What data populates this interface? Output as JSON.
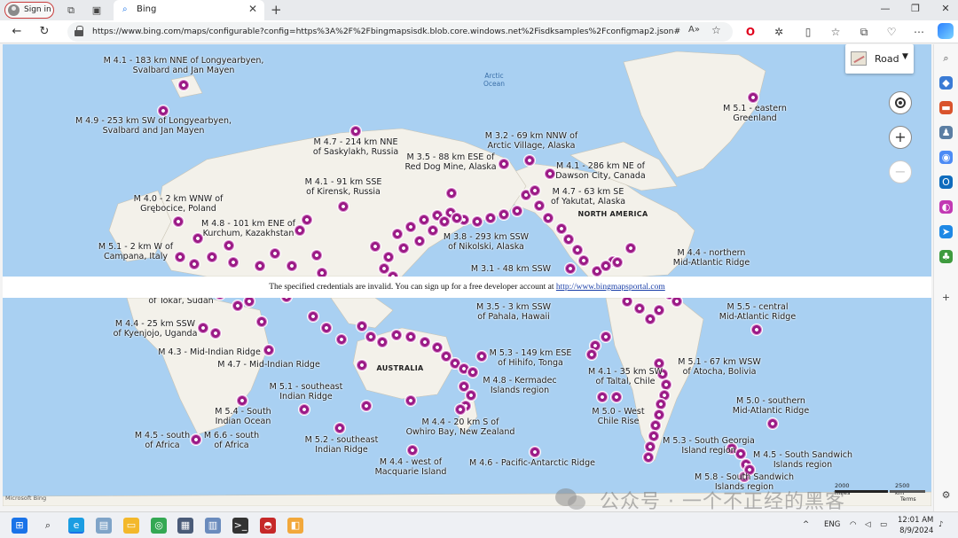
{
  "browser": {
    "signin_label": "Sign in",
    "tab_title": "Bing",
    "url": "https://www.bing.com/maps/configurable?config=https%3A%2F%2Fbingmapsisdk.blob.core.windows.net%2Fisdksamples%2Fconfigmap2.json#"
  },
  "map": {
    "style_label": "Road",
    "error_text": "The specified credentials are invalid. You can sign up for a free developer account at",
    "error_link": "http://www.bingmapsportal.com",
    "ocean_label": "Arctic\nOcean",
    "north_america": "NORTH AMERICA",
    "australia": "AUSTRALIA",
    "scale_km": "2500 km",
    "scale_mi": "2000 miles",
    "terms": "Terms",
    "logo": "Microsoft Bing",
    "earthquakes": [
      {
        "id": "eq1",
        "text": "M 4.1 - 183 km NNE of Longyearbyen,\nSvalbard and Jan Mayen"
      },
      {
        "id": "eq2",
        "text": "M 4.9 - 253 km SW of Longyearbyen,\nSvalbard and Jan Mayen"
      },
      {
        "id": "eq3",
        "text": "M 4.7 - 214 km NNE\nof Saskylakh, Russia"
      },
      {
        "id": "eq4",
        "text": "M 3.2 - 69 km NNW of\nArctic Village, Alaska"
      },
      {
        "id": "eq5",
        "text": "M 3.5 - 88 km ESE of\nRed Dog Mine, Alaska"
      },
      {
        "id": "eq6",
        "text": "M 4.1 - 286 km NE of\nDawson City, Canada"
      },
      {
        "id": "eq7",
        "text": "M 4.1 - 91 km SSE\nof Kirensk, Russia"
      },
      {
        "id": "eq8",
        "text": "M 4.7 - 63 km SE\nof Yakutat, Alaska"
      },
      {
        "id": "eq9",
        "text": "M 4.0 - 2 km WNW of\nGrębocice, Poland"
      },
      {
        "id": "eq10",
        "text": "M 4.8 - 101 km ENE of\nKurchum, Kazakhstan"
      },
      {
        "id": "eq11",
        "text": "M 3.8 - 293 km SSW\nof Nikolski, Alaska"
      },
      {
        "id": "eq12",
        "text": "M 5.1 - 2 km W of\nCampana, Italy"
      },
      {
        "id": "eq13",
        "text": "M 3.1 - 48 km SSW"
      },
      {
        "id": "eq14",
        "text": "M 4.4 - northern\nMid-Atlantic Ridge"
      },
      {
        "id": "eq15",
        "text": "M 5.1 - eastern\nGreenland"
      },
      {
        "id": "eq16",
        "text": "of Tokār, Sudan"
      },
      {
        "id": "eq17",
        "text": "M 3.5 - 3 km SSW\nof Pahala, Hawaii"
      },
      {
        "id": "eq18",
        "text": "M 5.5 - central\nMid-Atlantic Ridge"
      },
      {
        "id": "eq19",
        "text": "M 4.4 - 25 km SSW\nof Kyenjojo, Uganda"
      },
      {
        "id": "eq20",
        "text": "M 4.3 - Mid-Indian Ridge"
      },
      {
        "id": "eq21",
        "text": "M 4.7 - Mid-Indian Ridge"
      },
      {
        "id": "eq22",
        "text": "M 5.3 - 149 km ESE\nof Hihifo, Tonga"
      },
      {
        "id": "eq23",
        "text": "M 4.8 - Kermadec\nIslands region"
      },
      {
        "id": "eq24",
        "text": "M 5.1 - 67 km WSW\nof Atocha, Bolivia"
      },
      {
        "id": "eq25",
        "text": "M 4.1 - 35 km SW\nof Taltal, Chile"
      },
      {
        "id": "eq26",
        "text": "M 5.1 - southeast\nIndian Ridge"
      },
      {
        "id": "eq27",
        "text": "M 5.4 - South\nIndian Ocean"
      },
      {
        "id": "eq28",
        "text": "M 5.0 - West\nChile Rise"
      },
      {
        "id": "eq29",
        "text": "M 5.0 - southern\nMid-Atlantic Ridge"
      },
      {
        "id": "eq30",
        "text": "M 4.4 - 20 km S of\nOwhiro Bay, New Zealand"
      },
      {
        "id": "eq31",
        "text": "M 4.5 - south\nof Africa"
      },
      {
        "id": "eq32",
        "text": "M 6.6 - south\nof Africa"
      },
      {
        "id": "eq33",
        "text": "M 5.2 - southeast\nIndian Ridge"
      },
      {
        "id": "eq34",
        "text": "M 5.3 - South Georgia\nIsland region"
      },
      {
        "id": "eq35",
        "text": "M 4.5 - South Sandwich\nIslands region"
      },
      {
        "id": "eq36",
        "text": "M 4.4 - west of\nMacquarie Island"
      },
      {
        "id": "eq37",
        "text": "M 4.6 - Pacific-Antarctic Ridge"
      },
      {
        "id": "eq38",
        "text": "M 5.8 - South Sandwich\nIslands region"
      }
    ]
  },
  "watermark": "公众号 · 一个不正经的黑客",
  "taskbar": {
    "lang": "ENG",
    "time": "12:01 AM",
    "date": "8/9/2024"
  }
}
